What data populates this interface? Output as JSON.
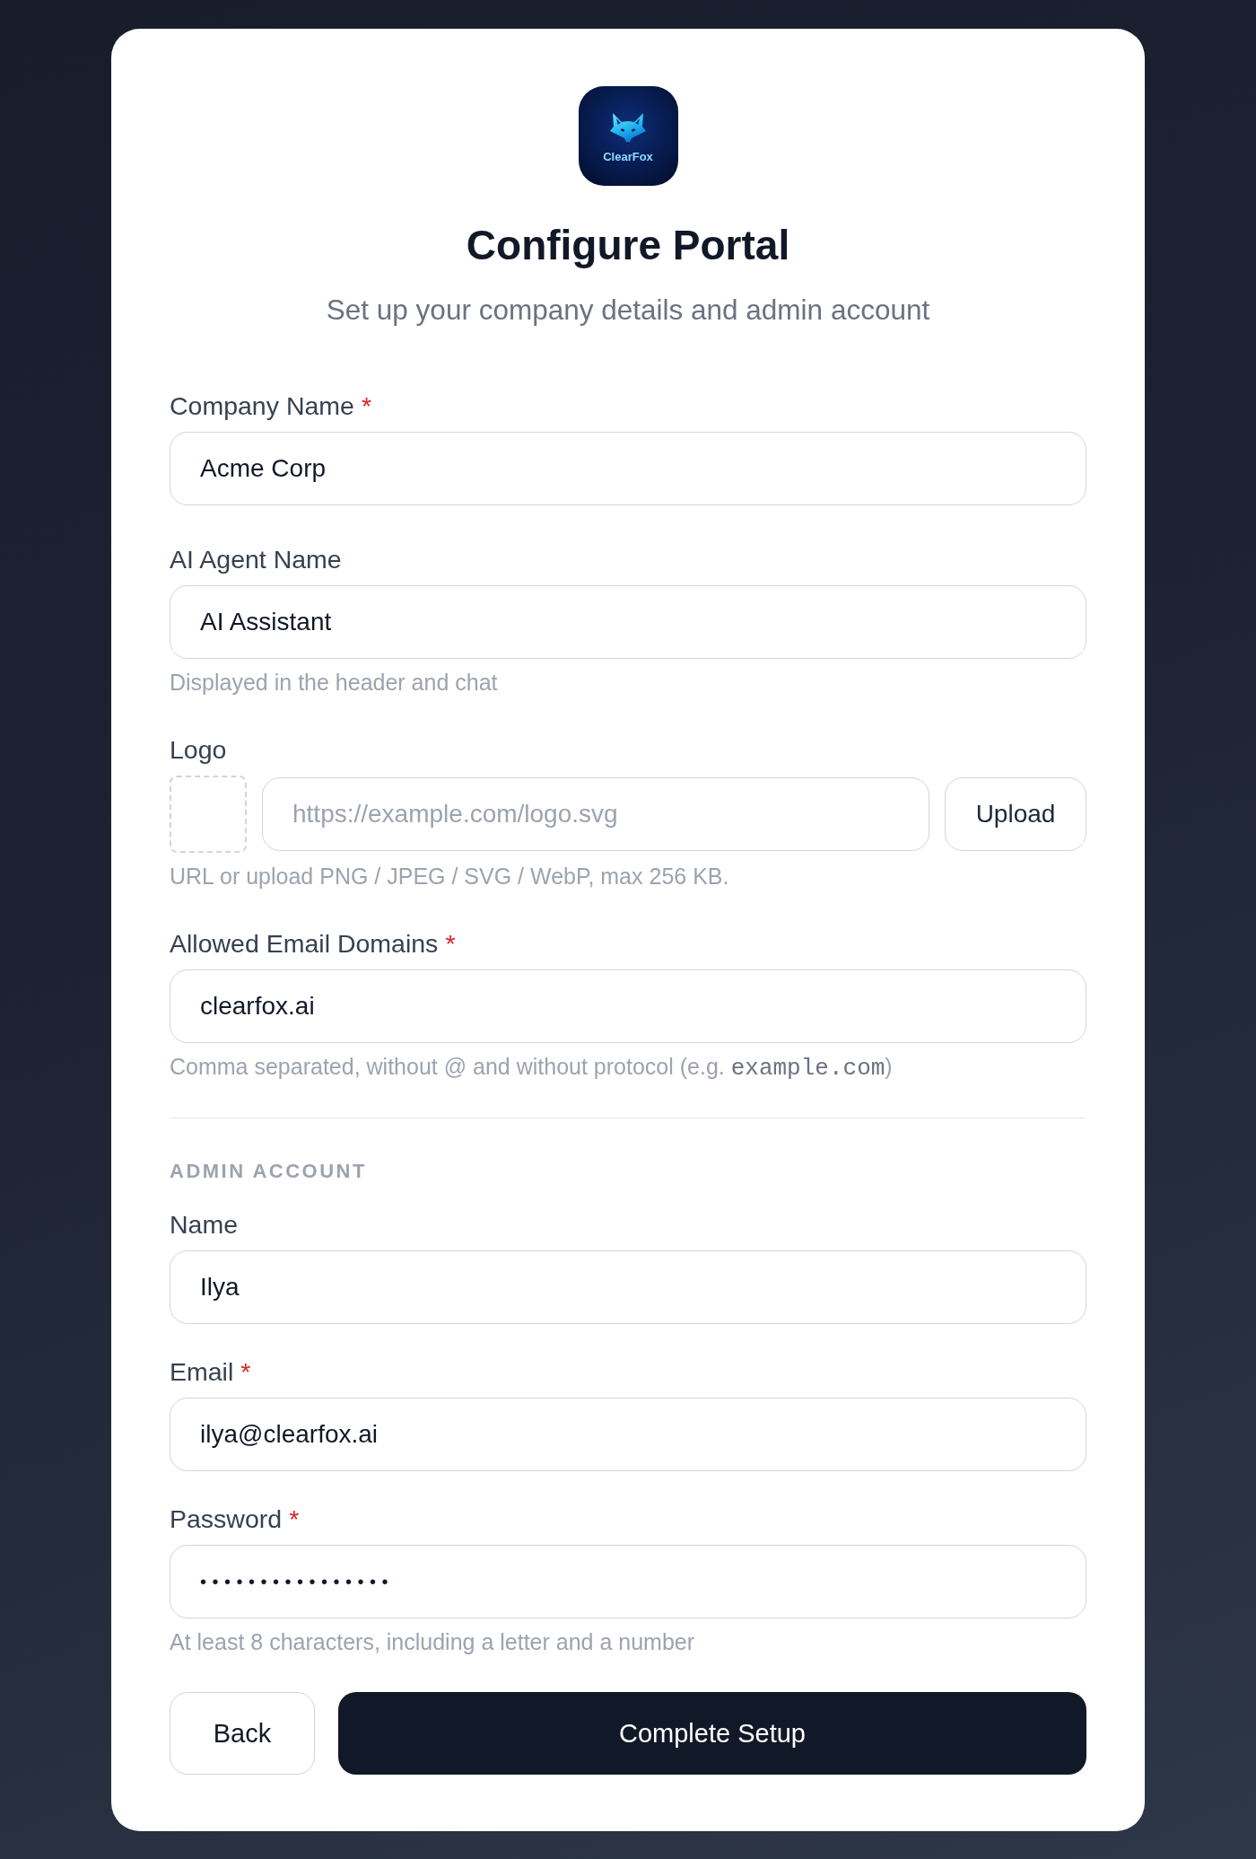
{
  "logo": {
    "text": "ClearFox"
  },
  "title": "Configure Portal",
  "subtitle": "Set up your company details and admin account",
  "company_fields": [
    {
      "kind": "text",
      "label": "Company Name",
      "required_mark": "*",
      "value": "Acme Corp"
    },
    {
      "kind": "text",
      "label": "AI Agent Name",
      "value": "AI Assistant",
      "hint": [
        {
          "text": "Displayed in the header and chat",
          "code": false
        }
      ]
    },
    {
      "kind": "url_upload",
      "label": "Logo",
      "placeholder": "https://example.com/logo.svg",
      "button": "Upload",
      "hint": [
        {
          "text": "URL or upload PNG / JPEG / SVG / WebP, max 256 KB.",
          "code": false
        }
      ]
    },
    {
      "kind": "text",
      "label": "Allowed Email Domains",
      "required_mark": "*",
      "value": "clearfox.ai",
      "hint": [
        {
          "text": "Comma separated, without @ and without protocol (e.g. ",
          "code": false
        },
        {
          "text": "example.com",
          "code": true
        },
        {
          "text": ")",
          "code": false
        }
      ]
    }
  ],
  "admin_section": {
    "title": "ADMIN ACCOUNT",
    "fields": [
      {
        "kind": "text",
        "label": "Name",
        "value": "Ilya"
      },
      {
        "kind": "text",
        "label": "Email",
        "required_mark": "*",
        "value": "ilya@clearfox.ai"
      },
      {
        "kind": "password",
        "label": "Password",
        "required_mark": "*",
        "value": "••••••••••••••••",
        "hint": [
          {
            "text": "At least 8 characters, including a letter and a number",
            "code": false
          }
        ]
      }
    ]
  },
  "buttons": [
    {
      "kind": "secondary",
      "label": "Back"
    },
    {
      "kind": "primary",
      "label": "Complete Setup"
    }
  ]
}
